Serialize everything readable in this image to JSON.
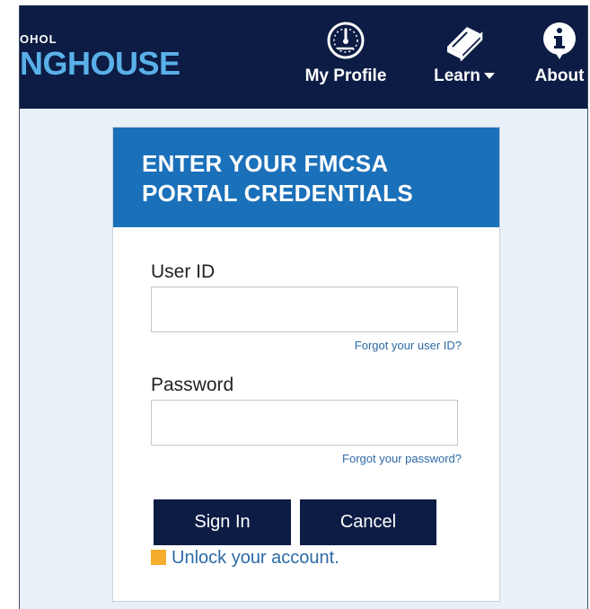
{
  "header": {
    "logo_top": "OHOL",
    "logo_main": "NGHOUSE",
    "nav": [
      {
        "label": "My Profile",
        "icon": "gauge-icon"
      },
      {
        "label": "Learn",
        "icon": "book-icon",
        "has_dropdown": true
      },
      {
        "label": "About",
        "icon": "info-icon"
      }
    ],
    "colors": {
      "background": "#0c1c44",
      "logo_accent": "#5ab0e8"
    }
  },
  "card": {
    "title_line1": "ENTER YOUR FMCSA",
    "title_line2": "PORTAL CREDENTIALS",
    "header_color": "#1b70ba"
  },
  "form": {
    "user_id_label": "User ID",
    "user_id_value": "",
    "forgot_user_id": "Forgot your user ID?",
    "password_label": "Password",
    "password_value": "",
    "forgot_password": "Forgot your password?",
    "sign_in_label": "Sign In",
    "cancel_label": "Cancel",
    "unlock_label": "Unlock your account."
  }
}
